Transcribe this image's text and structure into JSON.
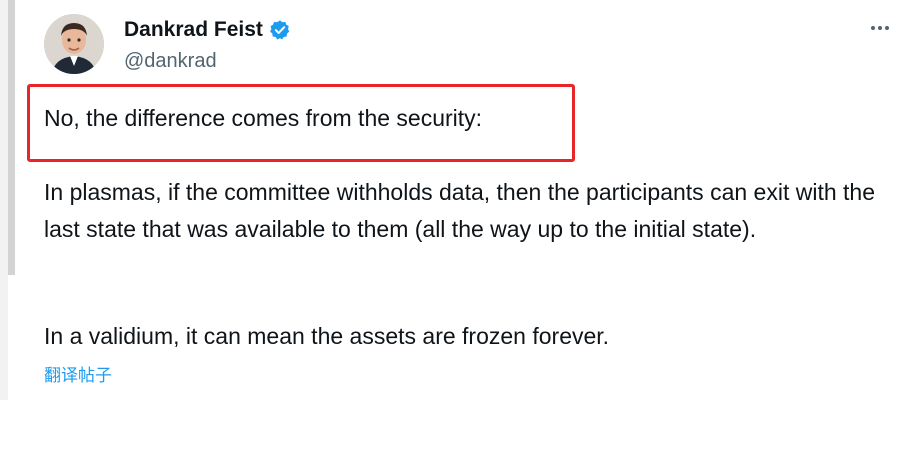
{
  "author": {
    "name": "Dankrad Feist",
    "handle": "@dankrad",
    "verified_color": "#1d9bf0"
  },
  "post": {
    "highlighted_line": "No, the difference comes from the security:",
    "paragraph_1": "In plasmas, if the committee withholds data, then the participants can exit with the last state that was available to them (all the way up to the initial state).",
    "paragraph_2": "In a validium, it can mean the assets are frozen forever.",
    "translate_link": "翻译帖子"
  },
  "colors": {
    "highlight": "#e8262a",
    "link": "#1d9bf0",
    "secondary_text": "#536471"
  }
}
